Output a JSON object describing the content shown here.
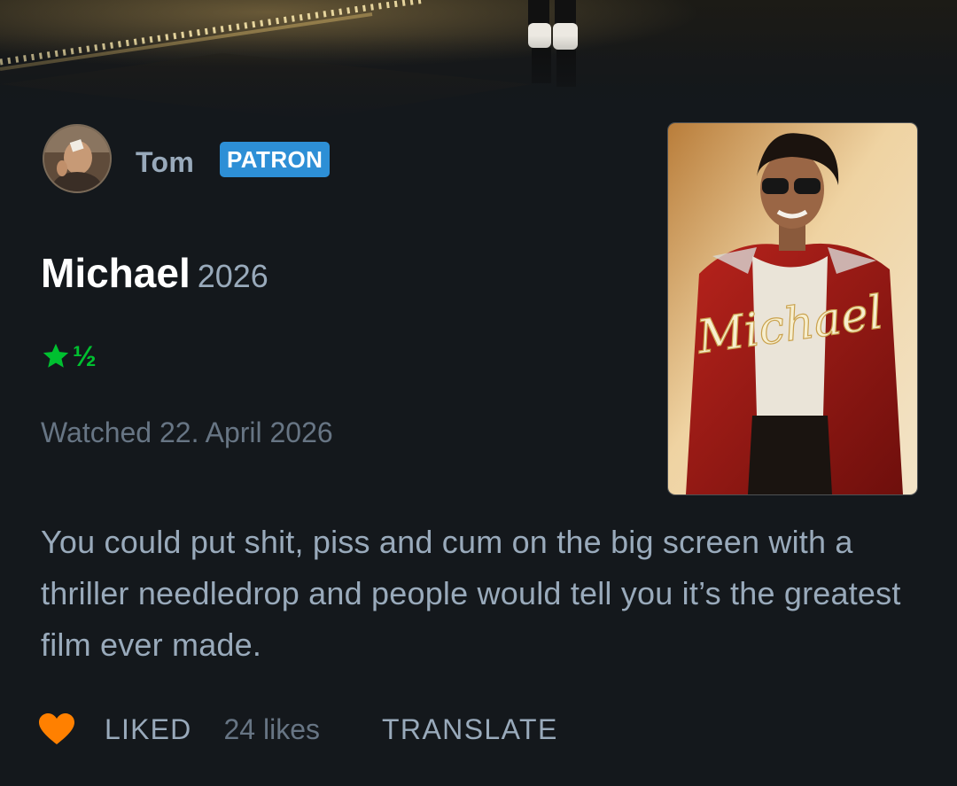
{
  "review": {
    "author": {
      "name": "Tom",
      "badge": "PATRON",
      "avatar_icon": "user-avatar"
    },
    "film": {
      "title": "Michael",
      "year": "2026",
      "poster_title_text": "Michael"
    },
    "rating": {
      "stars": 1.5,
      "half_glyph": "½",
      "icon": "star-icon",
      "color": "#00c030"
    },
    "watched_text": "Watched 22. April 2026",
    "body": "You could put shit, piss and cum on the big screen with a thriller needledrop and people would tell you it’s the greatest film ever made.",
    "actions": {
      "liked_label": "LIKED",
      "likes_count_label": "24 likes",
      "translate_label": "TRANSLATE",
      "heart_icon": "heart-icon",
      "heart_color": "#ff8000"
    }
  },
  "theme": {
    "background": "#14181c",
    "badge_color": "#2d8fd6",
    "text_muted": "#99aabb",
    "text_dim": "#677584"
  }
}
